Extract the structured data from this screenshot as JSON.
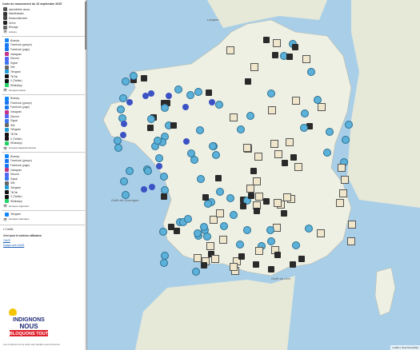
{
  "sidebar": {
    "title": "Carte du mouvement du 10 septembre 2025",
    "actions_legend": [
      "assemblées assoc.",
      "Manifestation",
      "Rassemblement",
      "Grève",
      "Blocage"
    ],
    "actions_label": "Actions",
    "groups_local": [
      "Bluesky",
      "Facebook (groupe)",
      "Facebook (page)",
      "Instagram",
      "Discord",
      "Signal",
      "Site",
      "Telegram",
      "TikTok",
      "X (Twitter)",
      "WhatsApp"
    ],
    "groups_local_label": "Groupes locaux",
    "groups_dept": [
      "Bluesky",
      "Facebook (groupe)",
      "Facebook (page)",
      "Instagram",
      "Discord",
      "Signal",
      "Site",
      "Telegram",
      "TikTok",
      "X (Twitter)",
      "WhatsApp"
    ],
    "groups_dept_label": "Groupes départementaux",
    "groups_regional": [
      "Bluesky",
      "Facebook (groupe)",
      "Facebook (page)",
      "Instagram",
      "Discord",
      "Signal",
      "Site",
      "Telegram",
      "TikTok",
      "X (Twitter)",
      "WhatsApp"
    ],
    "groups_regional_label": "Groupes régionaux",
    "national": [
      "Telegram"
    ],
    "national_label": "Groupes nationaux",
    "credits_title": "Crédits",
    "credits_line1": "Créé pour le contenu utilisateur",
    "credits_line2": "10s25",
    "credits_link": "Équipe web 10s25",
    "logo_line1": "INDIGNONS",
    "logo_line2": "NOUS",
    "logo_line3": "BLOQUONS TOUT",
    "footer": "Les contenus sur la carte sont publiés sous la licence"
  },
  "map": {
    "labels": {
      "langres": "Langres",
      "golfe": "Golfe de Gascogne",
      "golfe_lion": "Golfe du Lion"
    },
    "attribution": "Leaflet | OpenStreetMap"
  },
  "colors": {
    "sea": "#a9cfe8",
    "land": "#eef0e3",
    "marker_blue": "#5bb1d9",
    "marker_dark": "#2a2a2a"
  }
}
